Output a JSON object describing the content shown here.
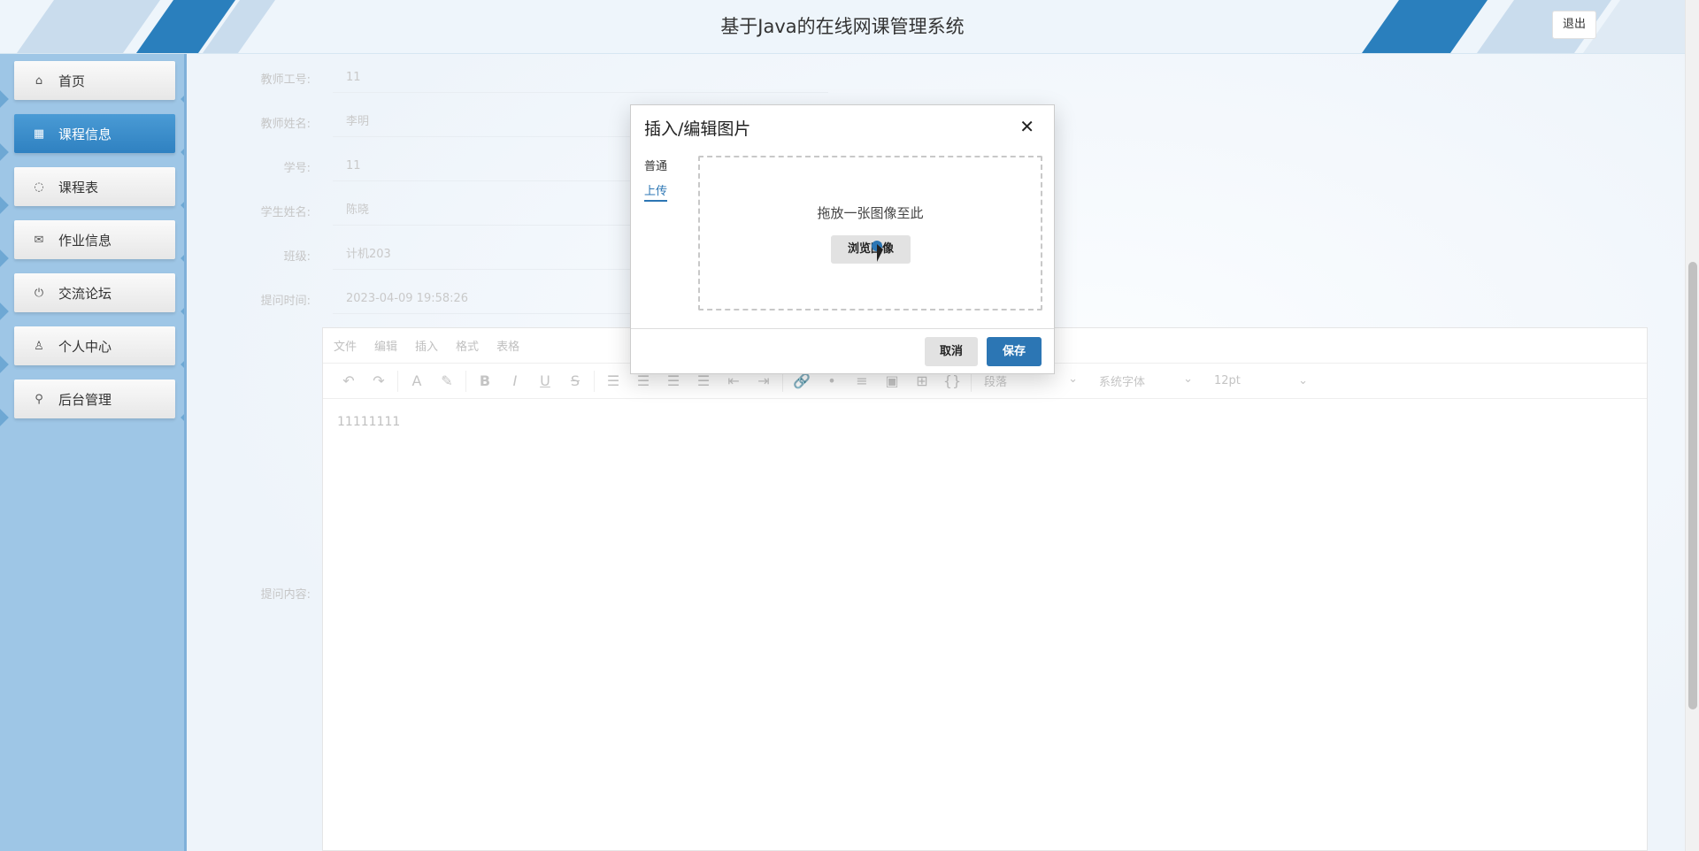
{
  "header": {
    "title": "基于Java的在线网课管理系统",
    "logout_label": "退出"
  },
  "sidebar": {
    "items": [
      {
        "label": "首页",
        "icon": "home-icon",
        "glyph": "⌂",
        "active": false
      },
      {
        "label": "课程信息",
        "icon": "course-icon",
        "glyph": "▦",
        "active": true
      },
      {
        "label": "课程表",
        "icon": "schedule-icon",
        "glyph": "◌",
        "active": false
      },
      {
        "label": "作业信息",
        "icon": "mail-icon",
        "glyph": "✉",
        "active": false
      },
      {
        "label": "交流论坛",
        "icon": "power-icon",
        "glyph": "⏻",
        "active": false
      },
      {
        "label": "个人中心",
        "icon": "user-icon",
        "glyph": "♙",
        "active": false
      },
      {
        "label": "后台管理",
        "icon": "link-icon",
        "glyph": "⚲",
        "active": false
      }
    ]
  },
  "form": {
    "teacher_id": {
      "label": "教师工号:",
      "value": "11"
    },
    "teacher_name": {
      "label": "教师姓名:",
      "value": "李明"
    },
    "student_id": {
      "label": "学号:",
      "value": "11"
    },
    "student_name": {
      "label": "学生姓名:",
      "value": "陈晓"
    },
    "class": {
      "label": "班级:",
      "value": "计机203"
    },
    "question_time": {
      "label": "提问时间:",
      "value": "2023-04-09 19:58:26"
    },
    "question_content": {
      "label": "提问内容:"
    }
  },
  "editor": {
    "menus": [
      "文件",
      "编辑",
      "插入",
      "格式",
      "表格"
    ],
    "paragraph_select": "段落",
    "font_select": "系统字体",
    "size_select": "12pt",
    "body_text": "11111111"
  },
  "modal": {
    "title": "插入/编辑图片",
    "close_glyph": "✕",
    "tab_general": "普通",
    "tab_upload": "上传",
    "drop_text": "拖放一张图像至此",
    "browse_label": "浏览图像",
    "cancel_label": "取消",
    "save_label": "保存"
  },
  "colors": {
    "accent": "#2c76b4",
    "sidebar_bg": "#9ec6e6",
    "active_nav": "#3a8cca"
  }
}
